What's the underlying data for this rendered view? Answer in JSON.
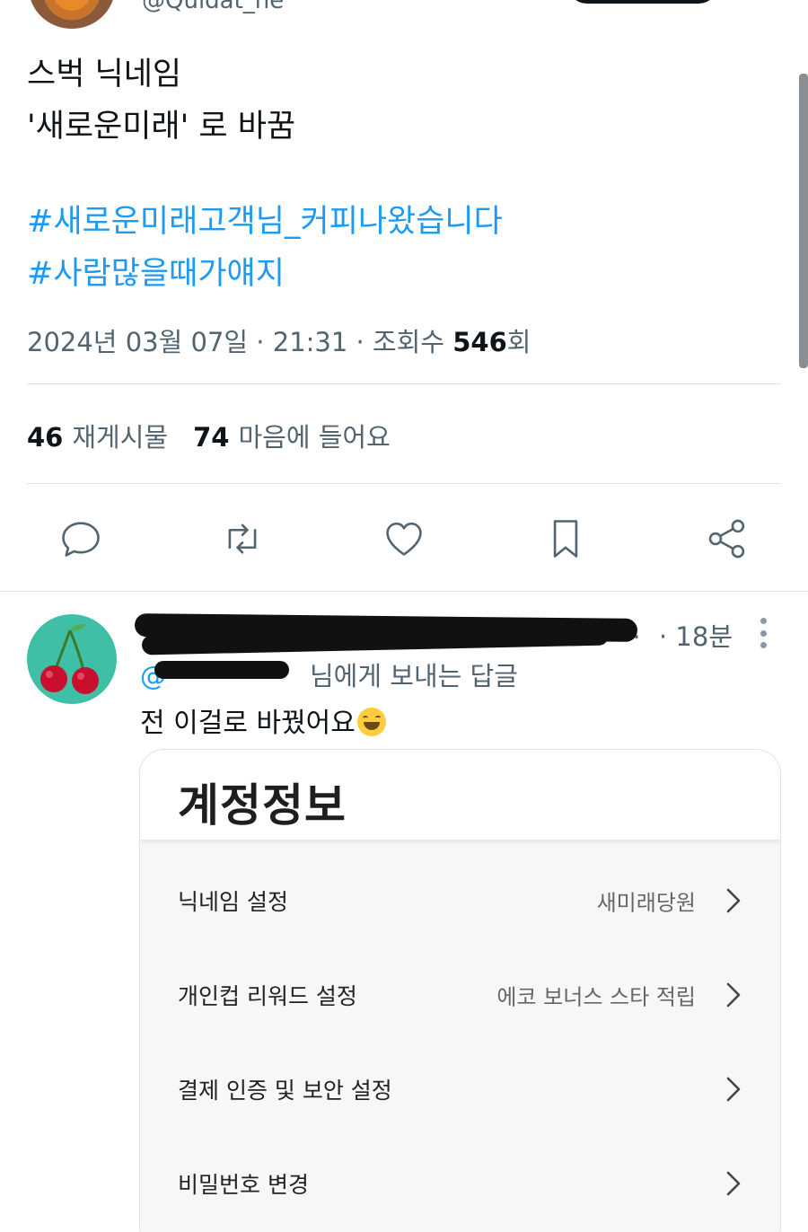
{
  "header": {
    "handle_partial": "@Quidat_ne"
  },
  "tweet": {
    "line1": "스벅 닉네임",
    "line2": "'새로운미래' 로 바꿈",
    "hashtag1": "#새로운미래고객님_커피나왔습니다",
    "hashtag2": "#사람많을때가얘지",
    "date_time": "2024년 03월 07일 · 21:31 · 조회수 ",
    "views": "546",
    "views_suffix": "회"
  },
  "stats": {
    "retweets_count": "46",
    "retweets_label": "재게시물",
    "likes_count": "74",
    "likes_label": "마음에 들어요"
  },
  "actions": {
    "icons": [
      "reply-icon",
      "retweet-icon",
      "like-icon",
      "bookmark-icon",
      "share-icon"
    ]
  },
  "reply": {
    "name_visible_tail": "...",
    "time": "· 18분",
    "replying_to_prefix": "@",
    "replying_to_suffix": "님에게 보내는 답글",
    "text": "전 이걸로 바꿨어요"
  },
  "card": {
    "title": "계정정보",
    "rows": [
      {
        "label": "닉네임 설정",
        "value": "새미래당원"
      },
      {
        "label": "개인컵 리워드 설정",
        "value": "에코 보너스 스타 적립"
      },
      {
        "label": "결제 인증 및 보안 설정",
        "value": ""
      },
      {
        "label": "비밀번호 변경",
        "value": ""
      }
    ]
  },
  "colors": {
    "link": "#1d9bf0",
    "secondary_text": "#536471",
    "primary_text": "#0f1419",
    "avatar_bg": "#3fbfa6"
  }
}
